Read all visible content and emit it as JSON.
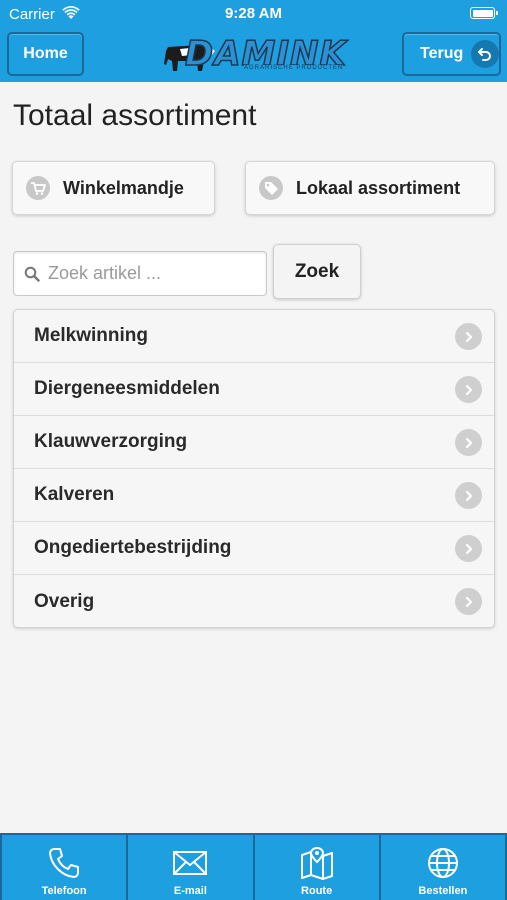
{
  "status": {
    "carrier": "Carrier",
    "time": "9:28 AM"
  },
  "header": {
    "home_label": "Home",
    "back_label": "Terug",
    "logo_text": "DAMINK",
    "logo_subtitle": "AGRARISCHE PRODUCTEN",
    "accent_color": "#1e9fe0"
  },
  "page": {
    "title": "Totaal assortiment"
  },
  "actions": {
    "cart_label": "Winkelmandje",
    "local_label": "Lokaal assortiment"
  },
  "search": {
    "placeholder": "Zoek artikel ...",
    "value": "",
    "button_label": "Zoek"
  },
  "categories": [
    {
      "label": "Melkwinning"
    },
    {
      "label": "Diergeneesmiddelen"
    },
    {
      "label": "Klauwverzorging"
    },
    {
      "label": "Kalveren"
    },
    {
      "label": "Ongediertebestrijding"
    },
    {
      "label": "Overig"
    }
  ],
  "bottom_nav": [
    {
      "label": "Telefoon",
      "icon": "phone-icon"
    },
    {
      "label": "E-mail",
      "icon": "mail-icon"
    },
    {
      "label": "Route",
      "icon": "map-icon"
    },
    {
      "label": "Bestellen",
      "icon": "globe-icon"
    }
  ]
}
